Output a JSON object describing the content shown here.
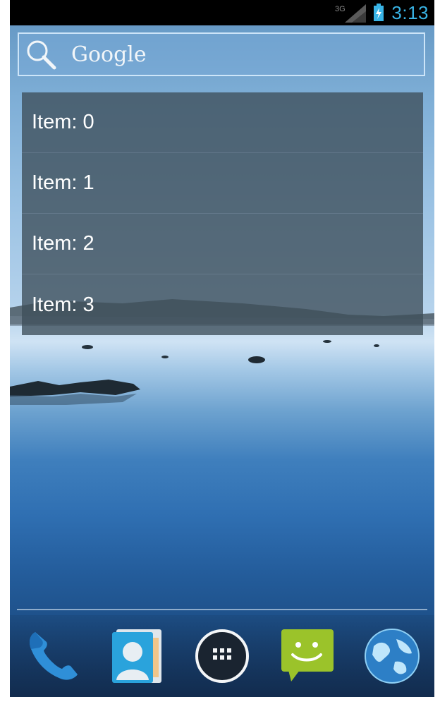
{
  "status_bar": {
    "network_label": "3G",
    "time": "3:13"
  },
  "search": {
    "label": "Google"
  },
  "list": {
    "items": [
      {
        "label": "Item: 0"
      },
      {
        "label": "Item: 1"
      },
      {
        "label": "Item: 2"
      },
      {
        "label": "Item: 3"
      }
    ]
  },
  "dock": {
    "apps": [
      "phone-icon",
      "contacts-icon",
      "app-drawer-icon",
      "messaging-icon",
      "browser-icon"
    ]
  },
  "colors": {
    "clock": "#39b4e6",
    "status_bar_bg": "#000000",
    "messaging": "#9bc32a"
  }
}
